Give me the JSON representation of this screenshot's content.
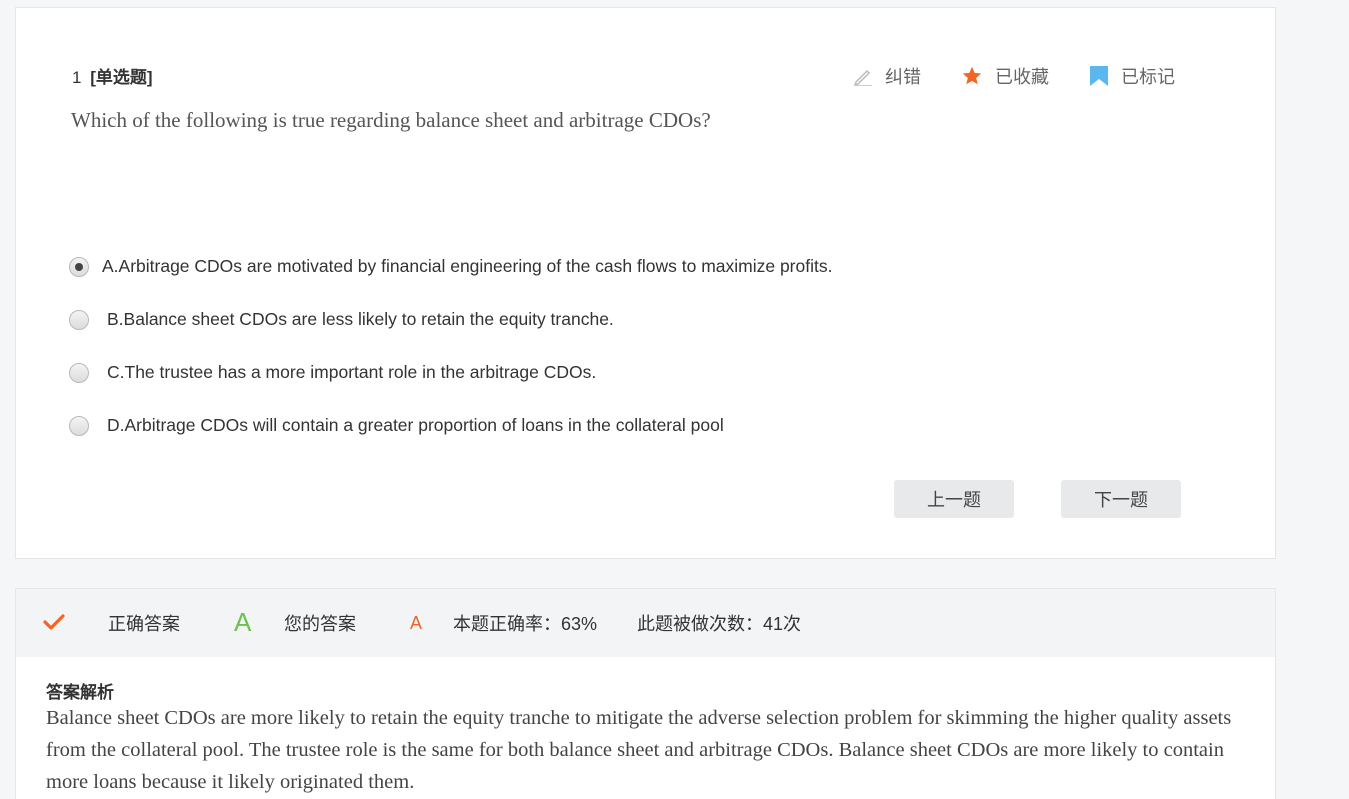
{
  "question": {
    "number": "1",
    "type": "[单选题]",
    "stem": "Which of the following is true regarding balance sheet and arbitrage CDOs?",
    "options": [
      {
        "label": "A.Arbitrage CDOs are motivated by financial engineering of the cash flows to maximize profits.",
        "checked": true
      },
      {
        "label": "B.Balance sheet CDOs are less likely to retain the equity tranche.",
        "checked": false
      },
      {
        "label": "C.The trustee has a more important role in the arbitrage CDOs.",
        "checked": false
      },
      {
        "label": "D.Arbitrage CDOs will contain a greater proportion of loans in the collateral pool",
        "checked": false
      }
    ]
  },
  "actions": {
    "report_label": "纠错",
    "favorite_label": "已收藏",
    "mark_label": "已标记"
  },
  "nav": {
    "prev_label": "上一题",
    "next_label": "下一题"
  },
  "result": {
    "correct_label": "正确答案",
    "correct_answer": "A",
    "your_label": "您的答案",
    "your_answer": "A",
    "accuracy_text": "本题正确率：63%",
    "attempts_text": "此题被做次数：41次"
  },
  "explanation": {
    "title": "答案解析",
    "text": "Balance sheet CDOs are more likely to retain the equity tranche to mitigate the adverse selection problem for skimming the higher quality assets from the collateral pool. The trustee role is the same for both balance sheet and arbitrage CDOs. Balance sheet CDOs are more likely to contain more loans because it likely originated them."
  },
  "colors": {
    "star": "#f26522",
    "bookmark": "#5bb8ee",
    "check": "#f26522",
    "correct_answer": "#6cc24a",
    "your_answer": "#e9642b"
  }
}
